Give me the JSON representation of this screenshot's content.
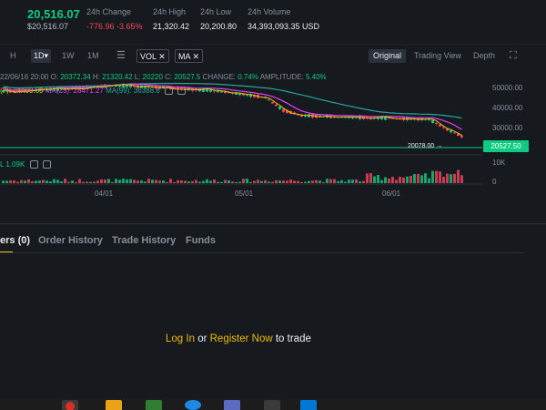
{
  "ticker": {
    "price": "20,516.07",
    "price_usd": "$20,516.07",
    "stats": [
      {
        "label": "24h Change",
        "value": "-776.96 -3.65%",
        "negative": true
      },
      {
        "label": "24h High",
        "value": "21,320.42"
      },
      {
        "label": "24h Low",
        "value": "20,200.80"
      },
      {
        "label": "24h Volume",
        "value": "34,393,093.35 USD"
      }
    ]
  },
  "toolbar": {
    "timeframes": [
      "H",
      "1D",
      "1W",
      "1M"
    ],
    "active_timeframe": "1D",
    "indicators": [
      "VOL",
      "MA"
    ],
    "views": [
      "Original",
      "Trading View",
      "Depth"
    ],
    "active_view": "Original"
  },
  "chart": {
    "ohlc": {
      "date": "22/06/16 20:00",
      "open_label": "O:",
      "open": "20372.34",
      "high_label": "H:",
      "high": "21320.42",
      "low_label": "L:",
      "low": "20220",
      "close_label": "C:",
      "close": "20527.5",
      "change_label": "CHANGE:",
      "change": "0.74%",
      "amplitude_label": "AMPLITUDE:",
      "amplitude": "5.40%"
    },
    "ma": {
      "ma7": "(7): 24499.89",
      "ma25": "MA(25): 28471.27",
      "ma99": "MA(99): 36388.8"
    },
    "vol_label": "L 1.09K",
    "y_ticks": [
      "50000.00",
      "40000.00",
      "30000.00",
      "20527.50",
      "10K",
      "0"
    ],
    "x_ticks": [
      "04/01",
      "05/01",
      "06/01"
    ],
    "last_price": "20527.50",
    "low_tag": "20078.00",
    "colors": {
      "up": "#0ecb81",
      "down": "#f6465d",
      "ma7": "#f0b90b",
      "ma25": "#e040fb",
      "ma99": "#26a69a"
    }
  },
  "orders": {
    "tabs": [
      "ers (0)",
      "Order History",
      "Trade History",
      "Funds"
    ],
    "active_tab": "ers (0)",
    "cta": {
      "login": "Log In",
      "or": "or",
      "register": "Register Now",
      "suffix": "to trade"
    }
  }
}
